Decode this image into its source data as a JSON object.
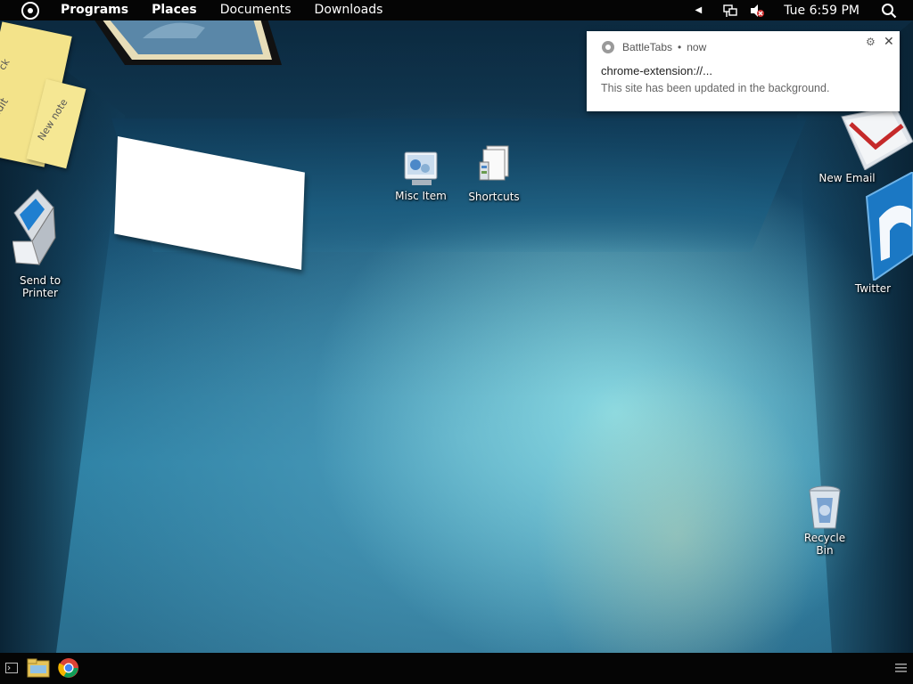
{
  "topbar": {
    "menu": [
      "Programs",
      "Places",
      "Documents",
      "Downloads"
    ],
    "clock": "Tue 6:59 PM"
  },
  "notification": {
    "app": "BattleTabs",
    "separator": "•",
    "time": "now",
    "title": "chrome-extension://...",
    "body": "This site has been updated in the background."
  },
  "desktop": {
    "icons": {
      "misc_item": "Misc Item",
      "shortcuts": "Shortcuts",
      "new_email": "New Email",
      "twitter": "Twitter",
      "send_to_printer_line1": "Send to",
      "send_to_printer_line2": "Printer",
      "recycle_bin": "Recycle Bin"
    },
    "sticky_notes": [
      "edit",
      "New note",
      "ck"
    ]
  },
  "colors": {
    "topbar_bg": "#050505",
    "taskbar_bg": "#050505",
    "notification_bg": "#ffffff",
    "sticky_note": "#f3e38a"
  }
}
